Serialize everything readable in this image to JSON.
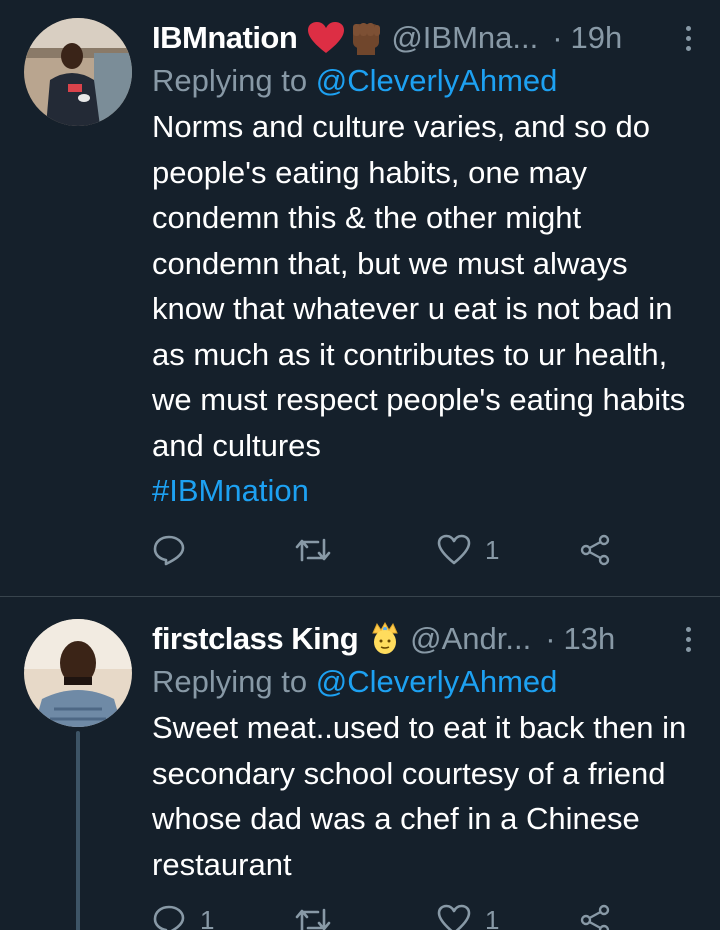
{
  "tweets": [
    {
      "display_name": "IBMnation",
      "emojis": [
        "red-heart",
        "raised-fist-dark-skin"
      ],
      "handle": "@IBMna...",
      "dot": "·",
      "time": "19h",
      "replying_prefix": "Replying to",
      "replying_to": "@CleverlyAhmed",
      "body": "Norms and culture varies, and so do people's eating habits, one may condemn this & the other might condemn that, but we must always know that whatever u eat is not bad in as much as it contributes to ur health, we must respect people's eating habits and cultures",
      "hashtag": "#IBMnation",
      "reply_count": "",
      "retweet_count": "",
      "like_count": "1"
    },
    {
      "display_name": "firstclass King",
      "emojis": [
        "person-with-crown"
      ],
      "handle": "@Andr...",
      "dot": "·",
      "time": "13h",
      "replying_prefix": "Replying to",
      "replying_to": "@CleverlyAhmed",
      "body": "Sweet meat..used to eat it back then in secondary school courtesy of a friend whose dad was a chef in a Chinese restaurant",
      "reply_count": "1",
      "retweet_count": "",
      "like_count": "1"
    }
  ],
  "colors": {
    "background": "#15202b",
    "text": "#ffffff",
    "muted": "#8899a6",
    "link": "#1da1f2",
    "divider": "#38444d"
  },
  "icons": [
    "reply-icon",
    "retweet-icon",
    "like-icon",
    "share-icon",
    "more-icon"
  ]
}
